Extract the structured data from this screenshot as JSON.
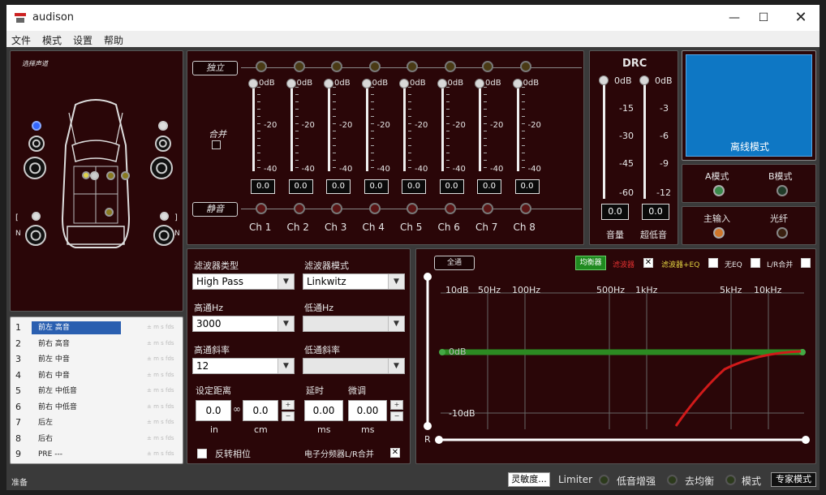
{
  "window": {
    "title": "audison"
  },
  "menu": [
    "文件",
    "模式",
    "设置",
    "帮助"
  ],
  "left_panel": {
    "title": "选择声道"
  },
  "channel_list": [
    {
      "num": "1",
      "name": "前左 高音",
      "delay": "± m s fds",
      "selected": true
    },
    {
      "num": "2",
      "name": "前右 高音",
      "delay": "± m s fds"
    },
    {
      "num": "3",
      "name": "前左 中音",
      "delay": "± m s fds"
    },
    {
      "num": "4",
      "name": "前右 中音",
      "delay": "± m s fds"
    },
    {
      "num": "5",
      "name": "前左 中低音",
      "delay": "± m s fds"
    },
    {
      "num": "6",
      "name": "前右 中低音",
      "delay": "± m s fds"
    },
    {
      "num": "7",
      "name": "后左",
      "delay": "± m s fds"
    },
    {
      "num": "8",
      "name": "后右",
      "delay": "± m s fds"
    },
    {
      "num": "9",
      "name": "PRE ---",
      "delay": "± m s fds"
    }
  ],
  "mixer": {
    "solo_label": "独立",
    "link_label": "合并",
    "mute_label": "静音",
    "scale_top": "0dB",
    "scale_mid": "-20",
    "scale_bot": "-40",
    "channels": [
      {
        "name": "Ch 1",
        "value": "0.0"
      },
      {
        "name": "Ch 2",
        "value": "0.0"
      },
      {
        "name": "Ch 3",
        "value": "0.0"
      },
      {
        "name": "Ch 4",
        "value": "0.0"
      },
      {
        "name": "Ch 5",
        "value": "0.0"
      },
      {
        "name": "Ch 6",
        "value": "0.0"
      },
      {
        "name": "Ch 7",
        "value": "0.0"
      },
      {
        "name": "Ch 8",
        "value": "0.0"
      }
    ]
  },
  "drc": {
    "title": "DRC",
    "master": {
      "label": "音量",
      "value": "0.0",
      "scale": [
        "0dB",
        "-15",
        "-30",
        "-45",
        "-60"
      ]
    },
    "sub": {
      "label": "超低音",
      "value": "0.0",
      "scale": [
        "0dB",
        "-3",
        "-6",
        "-9",
        "-12"
      ]
    }
  },
  "mode": {
    "offline_label": "离线模式",
    "a_label": "A模式",
    "b_label": "B模式",
    "main_input": "主输入",
    "optical": "光纤"
  },
  "filter": {
    "type_label": "滤波器类型",
    "type_value": "High Pass",
    "mode_label": "滤波器模式",
    "mode_value": "Linkwitz",
    "hp_label": "高通Hz",
    "hp_value": "3000",
    "lp_label": "低通Hz",
    "lp_value": "",
    "hp_slope_label": "高通斜率",
    "hp_slope_value": "12",
    "lp_slope_label": "低通斜率",
    "lp_slope_value": "",
    "distance_label": "设定距离",
    "dist_in": "0.0",
    "dist_cm": "0.0",
    "unit_in": "in",
    "unit_cm": "cm",
    "delay_label": "延时",
    "fine_label": "微调",
    "delay_value": "0.00",
    "fine_value": "0.00",
    "unit_ms": "ms",
    "invert_label": "反转相位",
    "xover_link_label": "电子分频器L/R合并"
  },
  "eq": {
    "all_pass": "全通",
    "equalizer": "均衡器",
    "filter": "滤波器",
    "filter_eq": "滤波器+EQ",
    "no_eq": "无EQ",
    "lr_link": "L/R合并",
    "r_label": "R",
    "freq_labels": [
      "10dB",
      "50Hz",
      "100Hz",
      "500Hz",
      "1kHz",
      "5kHz",
      "10kHz"
    ],
    "db_mid": "0dB",
    "db_low": "-10dB",
    "colors": {
      "eq_line": "#2c8a22",
      "filter_curve": "#d11a1a"
    }
  },
  "status": {
    "ready": "准备",
    "sensitivity": "灵敏度...",
    "limiter": "Limiter",
    "bass_boost": "低音增强",
    "de_eq": "去均衡",
    "mode": "模式",
    "expert": "专家模式"
  }
}
